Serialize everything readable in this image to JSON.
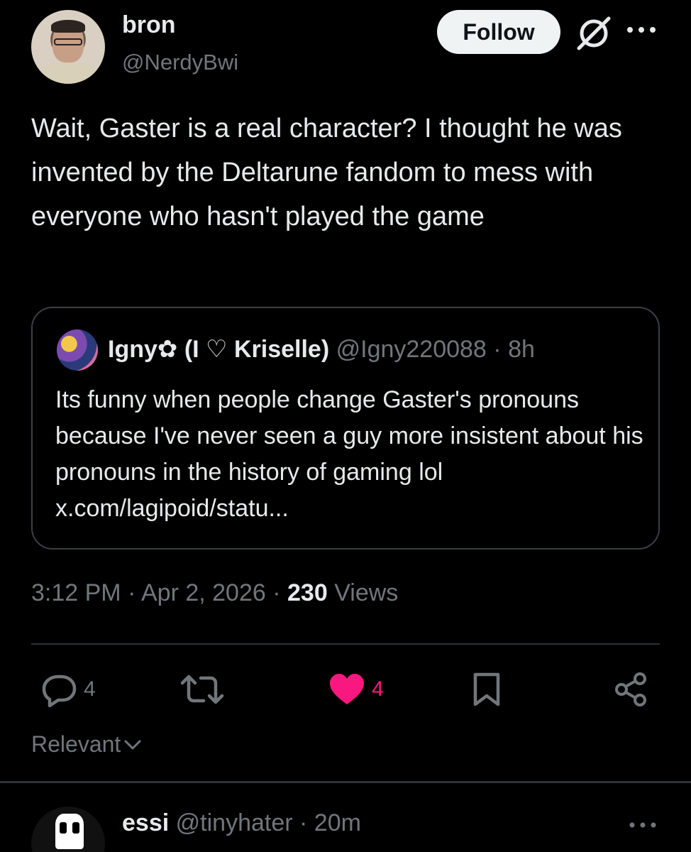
{
  "post": {
    "author_name": "bron",
    "author_handle": "@NerdyBwi",
    "follow_label": "Follow",
    "text": "Wait, Gaster is a real character? I thought he was invented by the Deltarune fandom to mess with everyone who hasn't played the game",
    "time": "3:12 PM",
    "date": "Apr 2, 2026",
    "views_count": "230",
    "views_label": "Views"
  },
  "quote": {
    "author_name": "Igny✿ (I ♡ Kriselle)",
    "author_handle": "@Igny220088",
    "age": "8h",
    "text": "Its funny when people change Gaster's pronouns because I've never seen a guy more insistent about his pronouns in the history of gaming lol x.com/lagipoid/statu..."
  },
  "actions": {
    "replies": "4",
    "likes": "4",
    "like_color": "#f91880"
  },
  "sort": {
    "label": "Relevant"
  },
  "reply": {
    "author_name": "essi",
    "author_handle": "@tinyhater",
    "age": "20m"
  },
  "icons": [
    "grok-icon",
    "more-icon",
    "reply-icon",
    "retweet-icon",
    "heart-icon",
    "bookmark-icon",
    "share-icon",
    "chevron-down-icon"
  ]
}
